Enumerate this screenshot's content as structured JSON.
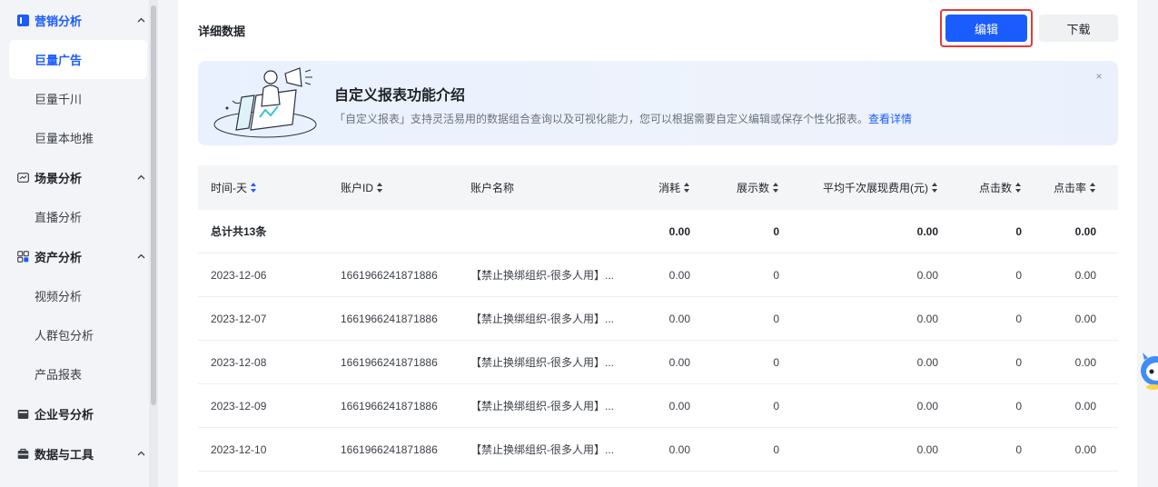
{
  "sidebar": {
    "groups": [
      {
        "label": "营销分析",
        "icon": "marketing-icon",
        "active": true,
        "items": [
          {
            "label": "巨量广告",
            "active": true
          },
          {
            "label": "巨量千川"
          },
          {
            "label": "巨量本地推"
          }
        ]
      },
      {
        "label": "场景分析",
        "icon": "scene-icon",
        "items": [
          {
            "label": "直播分析"
          }
        ]
      },
      {
        "label": "资产分析",
        "icon": "asset-icon",
        "items": [
          {
            "label": "视频分析"
          },
          {
            "label": "人群包分析"
          },
          {
            "label": "产品报表"
          }
        ]
      },
      {
        "label": "企业号分析",
        "icon": "enterprise-icon",
        "items": []
      },
      {
        "label": "数据与工具",
        "icon": "tools-icon",
        "items": []
      }
    ]
  },
  "main": {
    "title": "详细数据",
    "edit_label": "编辑",
    "download_label": "下载"
  },
  "banner": {
    "title": "自定义报表功能介绍",
    "desc": "「自定义报表」支持灵活易用的数据组合查询以及可视化能力，您可以根据需要自定义编辑或保存个性化报表。",
    "link": "查看详情",
    "close": "×"
  },
  "table": {
    "columns": [
      "时间-天",
      "账户ID",
      "账户名称",
      "消耗",
      "展示数",
      "平均千次展现费用(元)",
      "点击数",
      "点击率"
    ],
    "total": [
      "总计共13条",
      "",
      "",
      "0.00",
      "0",
      "0.00",
      "0",
      "0.00"
    ],
    "rows": [
      [
        "2023-12-06",
        "1661966241871886",
        "【禁止换绑组织-很多人用】...",
        "0.00",
        "0",
        "0.00",
        "0",
        "0.00"
      ],
      [
        "2023-12-07",
        "1661966241871886",
        "【禁止换绑组织-很多人用】...",
        "0.00",
        "0",
        "0.00",
        "0",
        "0.00"
      ],
      [
        "2023-12-08",
        "1661966241871886",
        "【禁止换绑组织-很多人用】...",
        "0.00",
        "0",
        "0.00",
        "0",
        "0.00"
      ],
      [
        "2023-12-09",
        "1661966241871886",
        "【禁止换绑组织-很多人用】...",
        "0.00",
        "0",
        "0.00",
        "0",
        "0.00"
      ],
      [
        "2023-12-10",
        "1661966241871886",
        "【禁止换绑组织-很多人用】...",
        "0.00",
        "0",
        "0.00",
        "0",
        "0.00"
      ]
    ]
  },
  "colors": {
    "accent": "#1b5cff",
    "highlight_border": "#e33a3a"
  }
}
